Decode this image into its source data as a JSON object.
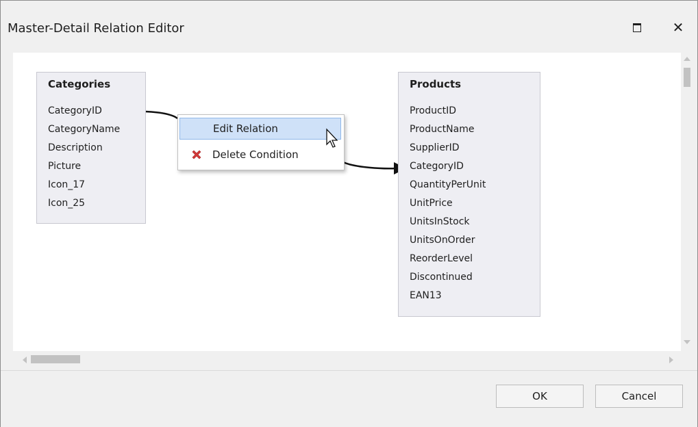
{
  "window": {
    "title": "Master-Detail Relation Editor"
  },
  "tables": {
    "master": {
      "title": "Categories",
      "fields": [
        "CategoryID",
        "CategoryName",
        "Description",
        "Picture",
        "Icon_17",
        "Icon_25"
      ]
    },
    "detail": {
      "title": "Products",
      "fields": [
        "ProductID",
        "ProductName",
        "SupplierID",
        "CategoryID",
        "QuantityPerUnit",
        "UnitPrice",
        "UnitsInStock",
        "UnitsOnOrder",
        "ReorderLevel",
        "Discontinued",
        "EAN13"
      ]
    }
  },
  "context_menu": {
    "items": [
      {
        "label": "Edit Relation",
        "icon": "none",
        "highlighted": true
      },
      {
        "label": "Delete Condition",
        "icon": "red-x-icon",
        "highlighted": false
      }
    ]
  },
  "footer": {
    "ok_label": "OK",
    "cancel_label": "Cancel"
  },
  "colors": {
    "table_background": "#eeeef3",
    "menu_highlight": "#cfe1f8",
    "delete_icon": "#d23a3a"
  }
}
